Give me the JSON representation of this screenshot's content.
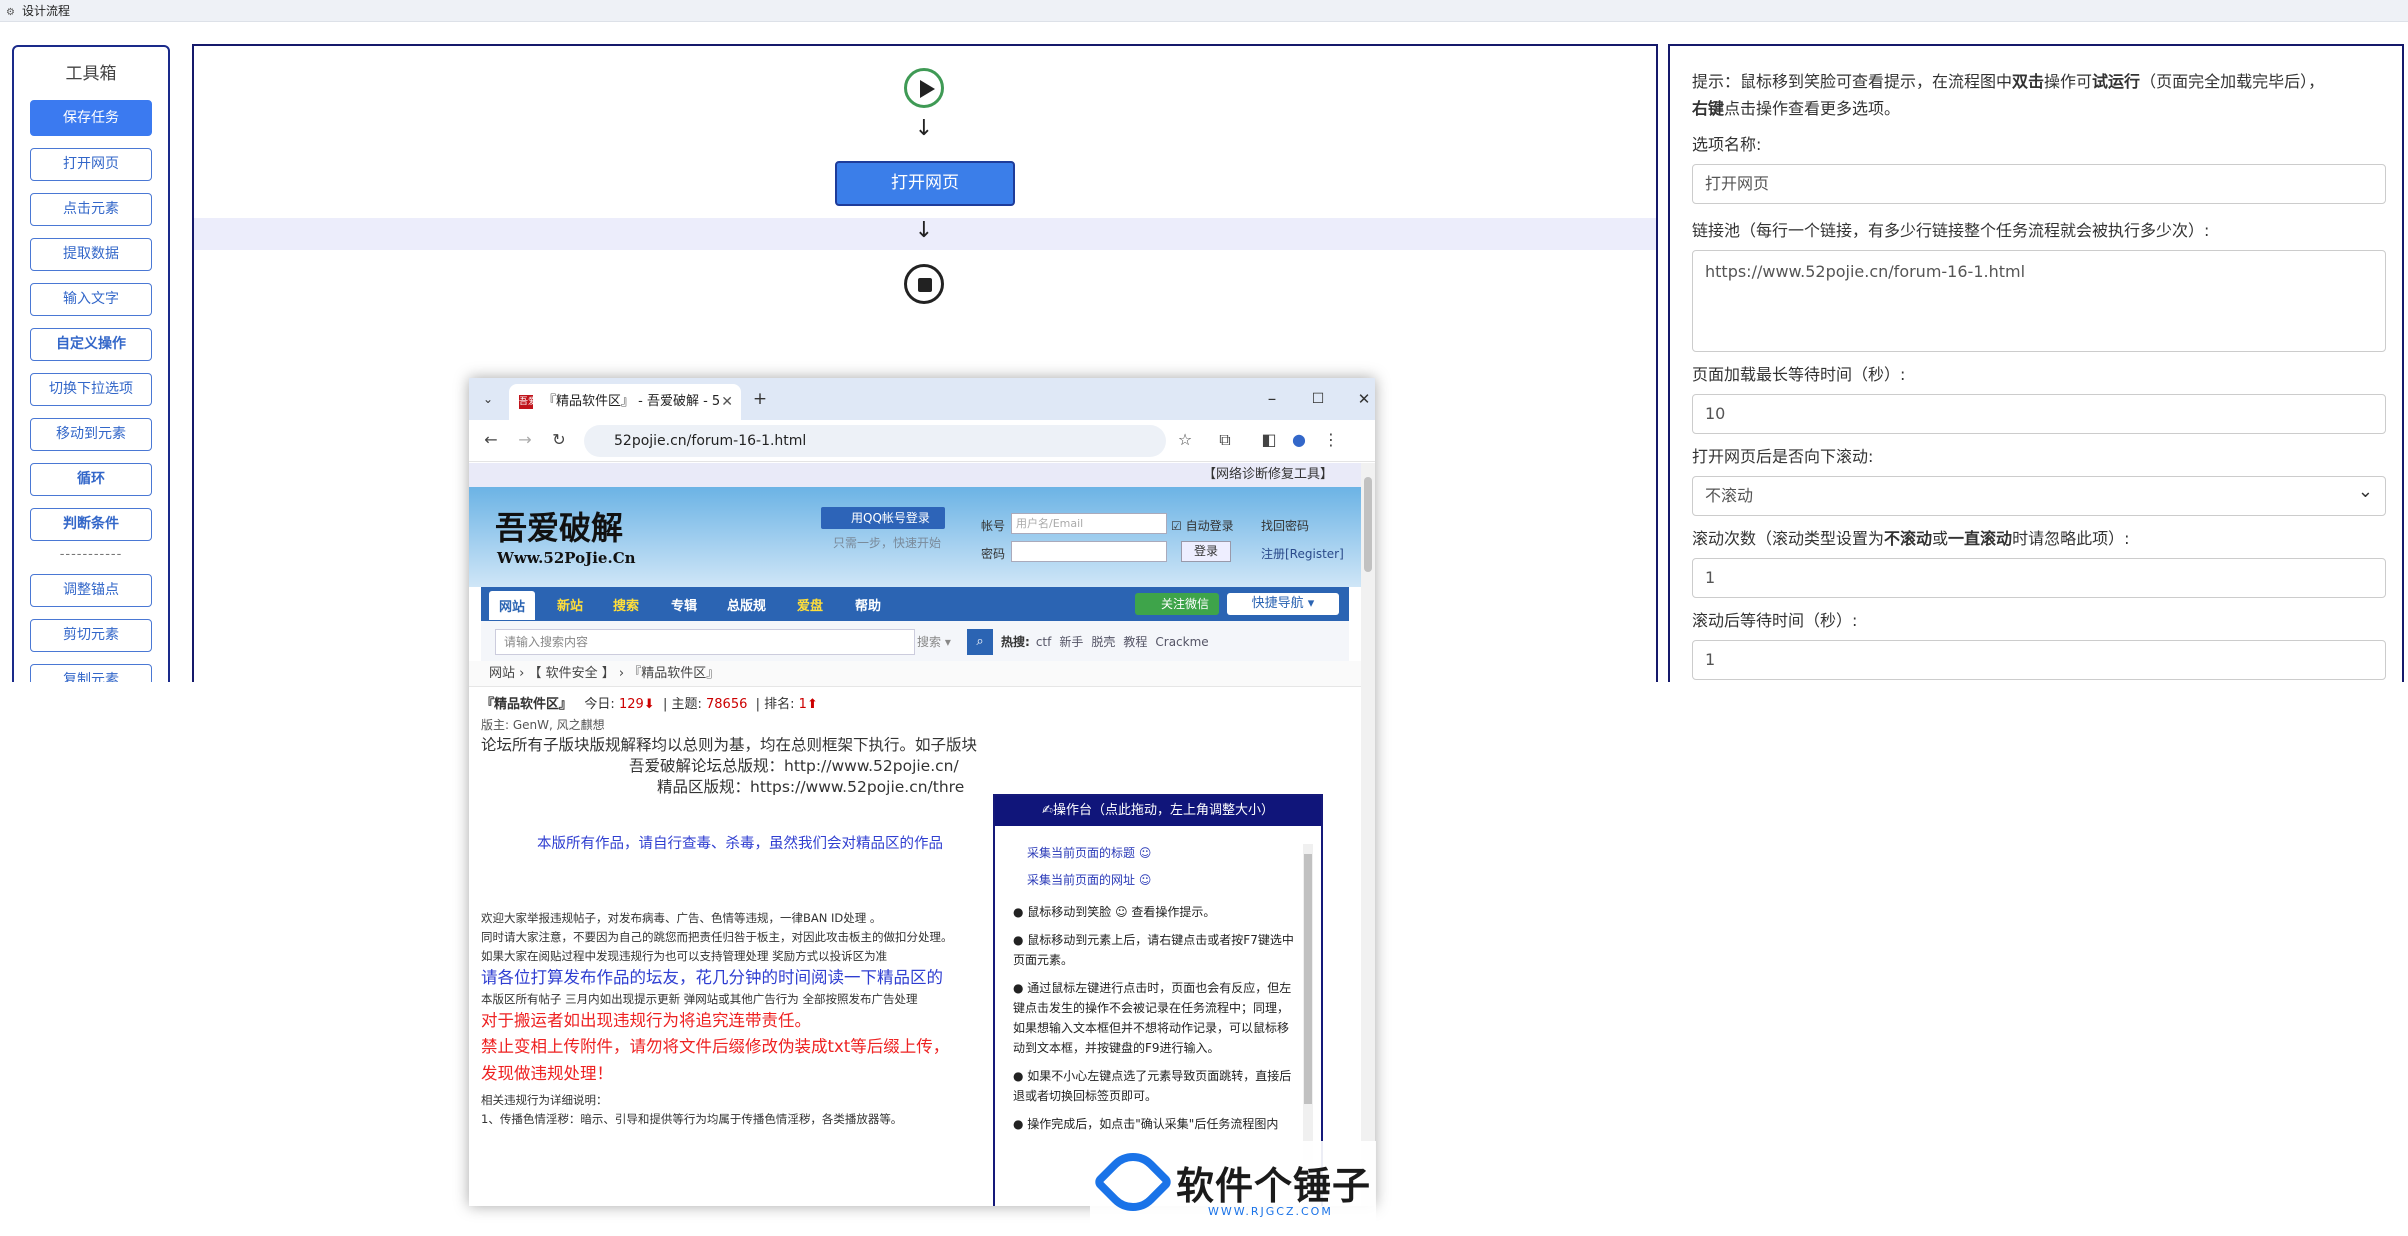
{
  "window": {
    "title": "设计流程"
  },
  "toolbox": {
    "title": "工具箱",
    "buttons": [
      "保存任务",
      "打开网页",
      "点击元素",
      "提取数据",
      "输入文字",
      "自定义操作",
      "切换下拉选项",
      "移动到元素",
      "循环",
      "判断条件"
    ],
    "separator": "-----------",
    "buttons2": [
      "调整锚点",
      "剪切元素",
      "复制元素"
    ]
  },
  "flow": {
    "arrow": "↓",
    "node_label": "打开网页"
  },
  "panel": {
    "tip_1": "提示：鼠标移到笑脸可查看提示，在流程图中",
    "tip_dbl": "双击",
    "tip_2": "操作可",
    "tip_test": "试运行",
    "tip_3": "（页面完全加载完毕后），",
    "tip_right": "右键",
    "tip_4": "点击操作查看更多选项。",
    "option_name_label": "选项名称:",
    "option_name_value": "打开网页",
    "link_pool_label": "链接池（每行一个链接，有多少行链接整个任务流程就会被执行多少次）:",
    "link_pool_value": "https://www.52pojie.cn/forum-16-1.html",
    "max_wait_label": "页面加载最长等待时间（秒）:",
    "max_wait_value": "10",
    "scroll_label": "打开网页后是否向下滚动:",
    "scroll_value": "不滚动",
    "scroll_count_label_1": "滚动次数（滚动类型设置为",
    "scroll_count_b1": "不滚动",
    "scroll_count_label_2": "或",
    "scroll_count_b2": "一直滚动",
    "scroll_count_label_3": "时请忽略此项）:",
    "scroll_count_value": "1",
    "after_wait_label": "滚动后等待时间（秒）:",
    "after_wait_value": "1"
  },
  "browser": {
    "tab_title": "『精品软件区』 - 吾爱破解 - 5",
    "favicon": "吾爱",
    "url": "52pojie.cn/forum-16-1.html",
    "net_fix": "【网络诊断修复工具】",
    "logo": "吾爱破解",
    "logo_sub": "Www.52PoJie.Cn",
    "qq_login": "用QQ帐号登录",
    "qq_tip": "只需一步，快速开始",
    "account_label": "帐号",
    "account_placeholder": "用户名/Email",
    "auto_login": "自动登录",
    "find_pwd": "找回密码",
    "pwd_label": "密码",
    "login": "登录",
    "register": "注册[Register]",
    "menu": [
      "网站",
      "新站",
      "搜索",
      "专辑",
      "总版规",
      "爱盘",
      "帮助"
    ],
    "wechat": "关注微信",
    "quick_nav": "快捷导航 ▾",
    "search_placeholder": "请输入搜索内容",
    "search_type": "搜索 ▾",
    "hot_label": "热搜:",
    "hot": [
      "ctf",
      "新手",
      "脱壳",
      "教程",
      "Crackme"
    ],
    "breadcrumb": "网站 › 【 软件安全 】 › 『精品软件区』",
    "forum_name": "『精品软件区』",
    "today_label": "今日:",
    "today": "129",
    "topics_label": "| 主题:",
    "topics": "78656",
    "rank_label": "| 排名:",
    "rank": "1",
    "mods": "版主: GenW, 风之麒想",
    "lines": [
      "论坛所有子版块版规解释均以总则为基，均在总则框架下执行。如子版块",
      "吾爱破解论坛总版规：http://www.52pojie.cn/",
      "精品区版规：https://www.52pojie.cn/thre",
      "本版所有作品，请自行查毒、杀毒，虽然我们会对精品区的作品",
      "欢迎大家举报违规帖子，对发布病毒、广告、色情等违规，一律BAN ID处理 。",
      "同时请大家注意，不要因为自己的跳您而把责任归咎于板主，对因此攻击板主的做扣分处理。",
      "如果大家在阅贴过程中发现违规行为也可以支持管理处理 奖励方式以投诉区为准",
      "请各位打算发布作品的坛友，花几分钟的时间阅读一下精品区的",
      "本版区所有帖子 三月内如出现提示更新 弹网站或其他广告行为 全部按照发布广告处理",
      "对于搬运者如出现违规行为将追究连带责任。",
      "禁止变相上传附件，请勿将文件后缀修改伪装成txt等后缀上传，",
      "发现做违规处理！",
      "相关违规行为详细说明：",
      "1、传播色情淫秽：暗示、引导和提供等行为均属于传播色情淫秽，各类播放器等。"
    ]
  },
  "console": {
    "title": "✍操作台（点此拖动，左上角调整大小）",
    "link1": "采集当前页面的标题 ☺",
    "link2": "采集当前页面的网址 ☺",
    "p1": "● 鼠标移动到笑脸 ☺ 查看操作提示。",
    "p2": "● 鼠标移动到元素上后，请右键点击或者按F7键选中页面元素。",
    "p3": "● 通过鼠标左键进行点击时，页面也会有反应，但左键点击发生的操作不会被记录在任务流程中；同理，如果想输入文本框但并不想将动作记录，可以鼠标移动到文本框，并按键盘的F9进行输入。",
    "p4": "● 如果不小心左键点选了元素导致页面跳转，直接后退或者切换回标签页即可。",
    "p5": "● 操作完成后，如点击\"确认采集\"后任务流程图内"
  },
  "watermark": {
    "title": "软件个锤子",
    "site": "WWW.RJGCZ.COM"
  }
}
